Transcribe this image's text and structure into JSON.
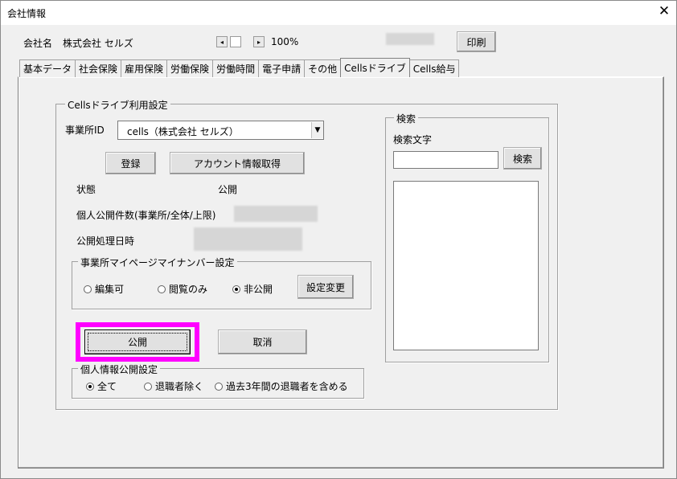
{
  "window": {
    "title": "会社情報",
    "close": "✕"
  },
  "header": {
    "company_label": "会社名",
    "company_name": "株式会社 セルズ",
    "zoom_left": "◂",
    "zoom_right": "▸",
    "zoom_value": "100%",
    "print_label": "印刷"
  },
  "tabs": [
    {
      "label": "基本データ"
    },
    {
      "label": "社会保険"
    },
    {
      "label": "雇用保険"
    },
    {
      "label": "労働保険"
    },
    {
      "label": "労働時間"
    },
    {
      "label": "電子申請"
    },
    {
      "label": "その他"
    },
    {
      "label": "Cellsドライブ"
    },
    {
      "label": "Cells給与"
    }
  ],
  "drive": {
    "group_title": "Cellsドライブ利用設定",
    "office_id_label": "事業所ID",
    "office_id_value": "cells（株式会社 セルズ）",
    "register_label": "登録",
    "account_label": "アカウント情報取得",
    "status_label": "状態",
    "status_value": "公開",
    "count_label": "個人公開件数(事業所/全体/上限)",
    "date_label": "公開処理日時",
    "mypage_title": "事業所マイページマイナンバー設定",
    "mypage_options": [
      "編集可",
      "閲覧のみ",
      "非公開"
    ],
    "mypage_selected": "非公開",
    "settings_change_label": "設定変更",
    "publish_label": "公開",
    "cancel_label": "取消",
    "personal_title": "個人情報公開設定",
    "personal_options": [
      "全て",
      "退職者除く",
      "過去3年間の退職者を含める"
    ],
    "personal_selected": "全て"
  },
  "search": {
    "group_title": "検索",
    "text_label": "検索文字",
    "input_value": "",
    "button_label": "検索"
  },
  "colors": {
    "highlight": "#ff00ff",
    "panel": "#f0f0f0"
  }
}
